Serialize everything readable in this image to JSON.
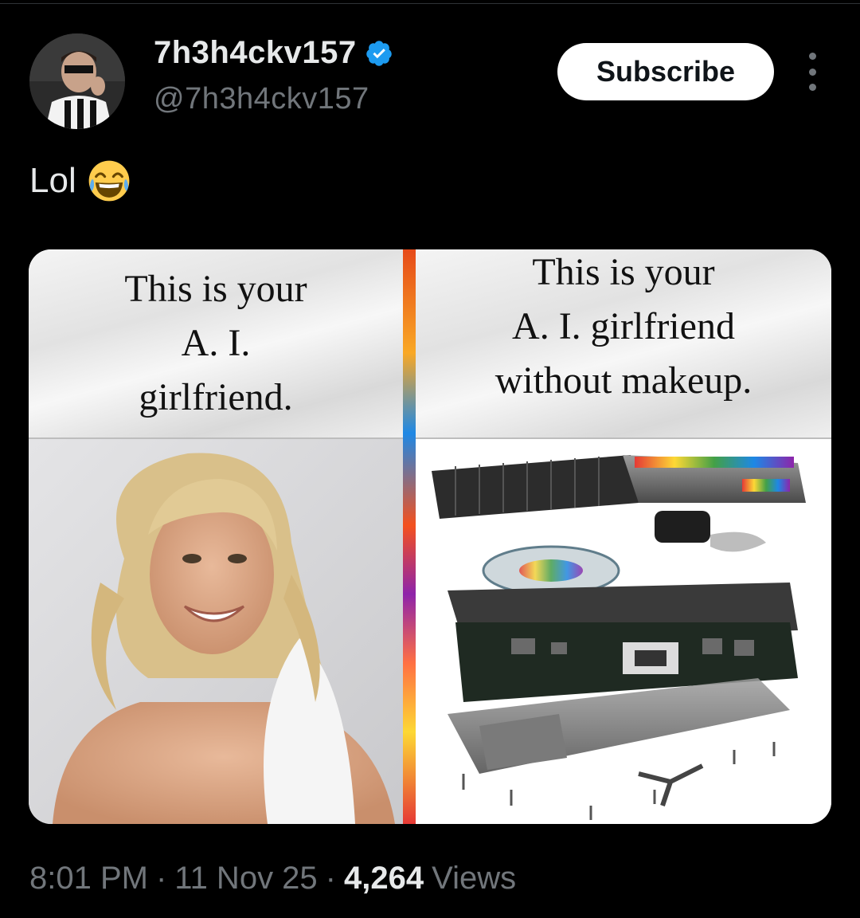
{
  "author": {
    "display_name": "7h3h4ckv157",
    "handle": "@7h3h4ckv157",
    "verified": true
  },
  "header": {
    "subscribe_label": "Subscribe"
  },
  "tweet": {
    "text": "Lol",
    "emoji": "face-with-tears-of-joy"
  },
  "media": {
    "left_caption": "This is your\nA. I.\ngirlfriend.",
    "right_caption": "This is your\nA. I. girlfriend\nwithout makeup."
  },
  "footer": {
    "time": "8:01 PM",
    "date": "11 Nov 25",
    "separator": "·",
    "views_count": "4,264",
    "views_label": "Views"
  },
  "colors": {
    "background": "#000000",
    "text_primary": "#e7e9ea",
    "text_secondary": "#71767b",
    "verified_blue": "#1d9bf0"
  }
}
